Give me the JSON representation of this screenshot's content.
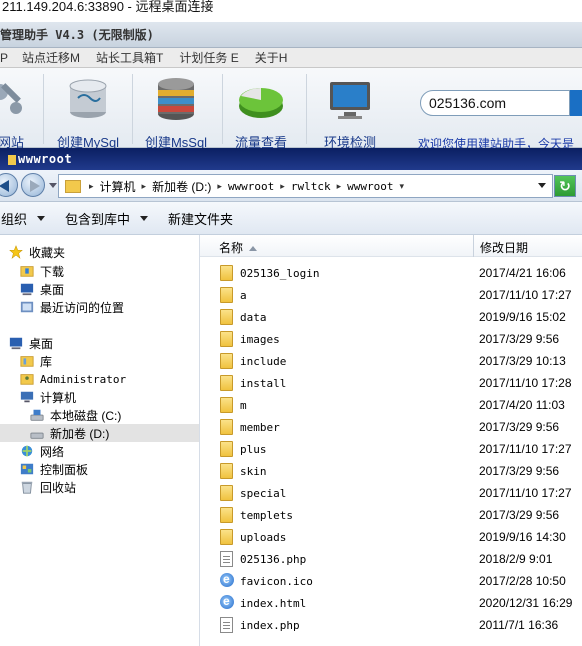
{
  "rdp": {
    "title": "211.149.204.6:33890 - 远程桌面连接"
  },
  "helper": {
    "title": "管理助手 V4.3 (无限制版)",
    "menu": [
      "P",
      "站点迁移M",
      "站长工具箱T",
      "计划任务 E",
      "关于H"
    ],
    "tools": [
      {
        "label": "网站",
        "icon": "wrench-icon"
      },
      {
        "label": "创建MySql",
        "icon": "mysql-database-icon"
      },
      {
        "label": "创建MsSql",
        "icon": "mssql-database-icon"
      },
      {
        "label": "流量查看",
        "icon": "pie-chart-icon"
      },
      {
        "label": "环境检测",
        "icon": "monitor-icon"
      }
    ],
    "search_value": "025136.com",
    "promo": "欢迎您使用建站助手，今天是"
  },
  "explorer": {
    "title": "wwwroot",
    "address": [
      "计算机",
      "新加卷 (D:)",
      "wwwroot",
      "rwltck",
      "wwwroot"
    ],
    "commands": [
      "组织",
      "包含到库中",
      "新建文件夹"
    ],
    "nav": [
      {
        "label": "收藏夹",
        "icon": "star-icon",
        "indent": 0
      },
      {
        "label": "下载",
        "icon": "download-folder-icon",
        "indent": 1
      },
      {
        "label": "桌面",
        "icon": "desktop-icon",
        "indent": 1
      },
      {
        "label": "最近访问的位置",
        "icon": "recent-places-icon",
        "indent": 1
      },
      {
        "label": "桌面",
        "icon": "desktop-icon",
        "indent": 0
      },
      {
        "label": "库",
        "icon": "library-icon",
        "indent": 1
      },
      {
        "label": "Administrator",
        "icon": "user-folder-icon",
        "indent": 1
      },
      {
        "label": "计算机",
        "icon": "computer-icon",
        "indent": 1
      },
      {
        "label": "本地磁盘 (C:)",
        "icon": "drive-icon",
        "indent": 2
      },
      {
        "label": "新加卷 (D:)",
        "icon": "drive-icon",
        "indent": 2
      },
      {
        "label": "网络",
        "icon": "network-icon",
        "indent": 1
      },
      {
        "label": "控制面板",
        "icon": "control-panel-icon",
        "indent": 1
      },
      {
        "label": "回收站",
        "icon": "recycle-bin-icon",
        "indent": 1
      }
    ],
    "selected_nav": "新加卷 (D:)",
    "columns": {
      "name": "名称",
      "date": "修改日期"
    },
    "files": [
      {
        "name": "025136_login",
        "date": "2017/4/21 16:06",
        "type": "folder"
      },
      {
        "name": "a",
        "date": "2017/11/10 17:27",
        "type": "folder"
      },
      {
        "name": "data",
        "date": "2019/9/16 15:02",
        "type": "folder"
      },
      {
        "name": "images",
        "date": "2017/3/29 9:56",
        "type": "folder"
      },
      {
        "name": "include",
        "date": "2017/3/29 10:13",
        "type": "folder"
      },
      {
        "name": "install",
        "date": "2017/11/10 17:28",
        "type": "folder"
      },
      {
        "name": "m",
        "date": "2017/4/20 11:03",
        "type": "folder"
      },
      {
        "name": "member",
        "date": "2017/3/29 9:56",
        "type": "folder"
      },
      {
        "name": "plus",
        "date": "2017/11/10 17:27",
        "type": "folder"
      },
      {
        "name": "skin",
        "date": "2017/3/29 9:56",
        "type": "folder"
      },
      {
        "name": "special",
        "date": "2017/11/10 17:27",
        "type": "folder"
      },
      {
        "name": "templets",
        "date": "2017/3/29 9:56",
        "type": "folder"
      },
      {
        "name": "uploads",
        "date": "2019/9/16 14:30",
        "type": "folder"
      },
      {
        "name": "025136.php",
        "date": "2018/2/9 9:01",
        "type": "php"
      },
      {
        "name": "favicon.ico",
        "date": "2017/2/28 10:50",
        "type": "ico"
      },
      {
        "name": "index.html",
        "date": "2020/12/31 16:29",
        "type": "html"
      },
      {
        "name": "index.php",
        "date": "2011/7/1 16:36",
        "type": "php"
      }
    ]
  }
}
